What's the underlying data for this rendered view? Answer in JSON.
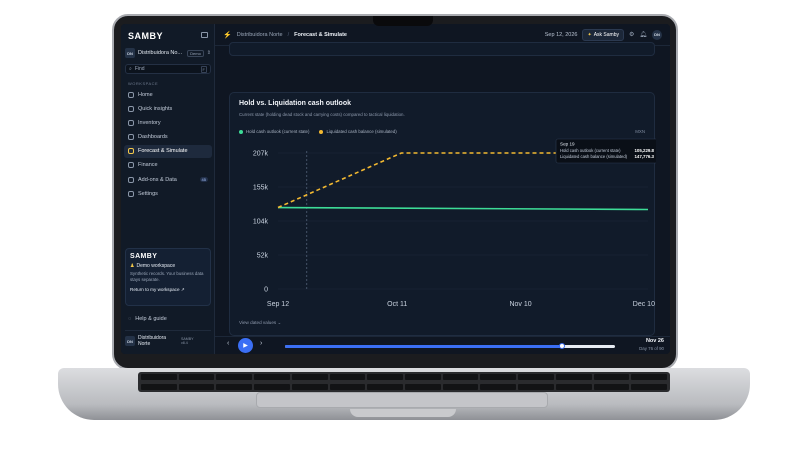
{
  "app": {
    "logo": "SAMBY"
  },
  "sidebar": {
    "org_initials": "DN",
    "org_name": "Distribuidora No...",
    "org_badge": "Demo",
    "find_label": "Find",
    "find_shortcut": "F",
    "section_label": "WORKSPACE",
    "items": [
      {
        "label": "Home",
        "icon": "home-icon"
      },
      {
        "label": "Quick insights",
        "icon": "sparkle-icon"
      },
      {
        "label": "Inventory",
        "icon": "box-icon"
      },
      {
        "label": "Dashboards",
        "icon": "grid-icon"
      },
      {
        "label": "Forecast & Simulate",
        "icon": "trend-icon",
        "active": true
      },
      {
        "label": "Finance",
        "icon": "wallet-icon"
      },
      {
        "label": "Add-ons & Data",
        "icon": "plug-icon",
        "badge": "45"
      },
      {
        "label": "Settings",
        "icon": "gear-icon"
      }
    ],
    "promo": {
      "logo": "SAMBY",
      "title": "Demo workspace",
      "text": "Synthetic records. Your business data stays separate.",
      "link": "Return to my workspace"
    },
    "help_label": "Help & guide",
    "user": {
      "initials": "DN",
      "name": "Distribuidora Norte",
      "meta_line1": "SAMBY",
      "meta_line2": "v8.4"
    }
  },
  "topbar": {
    "breadcrumb_parent": "Distribuidora Norte",
    "breadcrumb_separator": "/",
    "breadcrumb_current": "Forecast & Simulate",
    "date": "Sep 12, 2026",
    "ask_label": "Ask Samby",
    "avatar": "DN"
  },
  "card": {
    "title": "Hold vs. Liquidation cash outlook",
    "subtitle": "Current state (holding dead stock and carrying costs) compared to tactical liquidation.",
    "right_label": "MXN",
    "view_dated": "View dated values"
  },
  "tooltip": {
    "date": "Sep 19",
    "rows": [
      {
        "label": "Hold cash outlook (current state)",
        "value": "105,229.8"
      },
      {
        "label": "Liquidated cash balance (simulated)",
        "value": "147,776.3"
      }
    ]
  },
  "player": {
    "date": "Nov 26",
    "day": "Day 76 of 90",
    "progress": 0.84
  },
  "colors": {
    "hold": "#3ddc97",
    "liquidated": "#f3b931",
    "accent": "#3b6ff5"
  },
  "chart_data": {
    "type": "line",
    "title": "Hold vs. Liquidation cash outlook",
    "xlabel": "",
    "ylabel": "",
    "x_ticks": [
      "Sep 12",
      "Oct 11",
      "Nov 10",
      "Dec 10"
    ],
    "y_ticks": [
      "0",
      "52k",
      "104k",
      "155k",
      "207k"
    ],
    "ylim": [
      0,
      207000
    ],
    "x_day_range": [
      0,
      90
    ],
    "legend_position": "top-left",
    "grid": true,
    "series": [
      {
        "name": "Hold cash outlook (current state)",
        "style": "solid",
        "points": [
          [
            0,
            124000
          ],
          [
            90,
            121000
          ]
        ]
      },
      {
        "name": "Liquidated cash balance (simulated)",
        "style": "dashed",
        "points": [
          [
            0,
            124000
          ],
          [
            30,
            207000
          ],
          [
            90,
            207000
          ]
        ]
      }
    ]
  }
}
